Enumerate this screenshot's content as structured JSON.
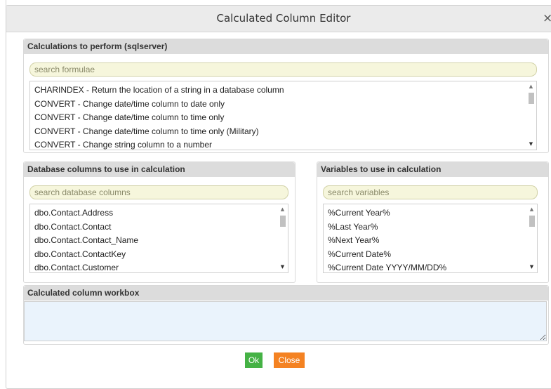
{
  "dialog": {
    "title": "Calculated Column Editor",
    "close_glyph": "×"
  },
  "formulas": {
    "header": "Calculations to perform (sqlserver)",
    "search_placeholder": "search formulae",
    "items": [
      "CHARINDEX - Return the location of a string in a database column",
      "CONVERT - Change date/time column to date only",
      "CONVERT - Change date/time column to time only",
      "CONVERT - Change date/time column to time only (Military)",
      "CONVERT - Change string column to a number"
    ]
  },
  "columns": {
    "header": "Database columns to use in calculation",
    "search_placeholder": "search database columns",
    "items": [
      "dbo.Contact.Address",
      "dbo.Contact.Contact",
      "dbo.Contact.Contact_Name",
      "dbo.Contact.ContactKey",
      "dbo.Contact.Customer"
    ]
  },
  "variables": {
    "header": "Variables to use in calculation",
    "search_placeholder": "search variables",
    "items": [
      "%Current Year%",
      "%Last Year%",
      "%Next Year%",
      "%Current Date%",
      "%Current Date YYYY/MM/DD%"
    ]
  },
  "workbox": {
    "header": "Calculated column workbox",
    "value": ""
  },
  "buttons": {
    "ok": "Ok",
    "close": "Close"
  },
  "colors": {
    "ok_button": "#45b245",
    "close_button": "#f48222",
    "search_bg": "#f6f6dc",
    "workbox_bg": "#eaf3fc",
    "panel_header_bg": "#dcdcdc"
  }
}
